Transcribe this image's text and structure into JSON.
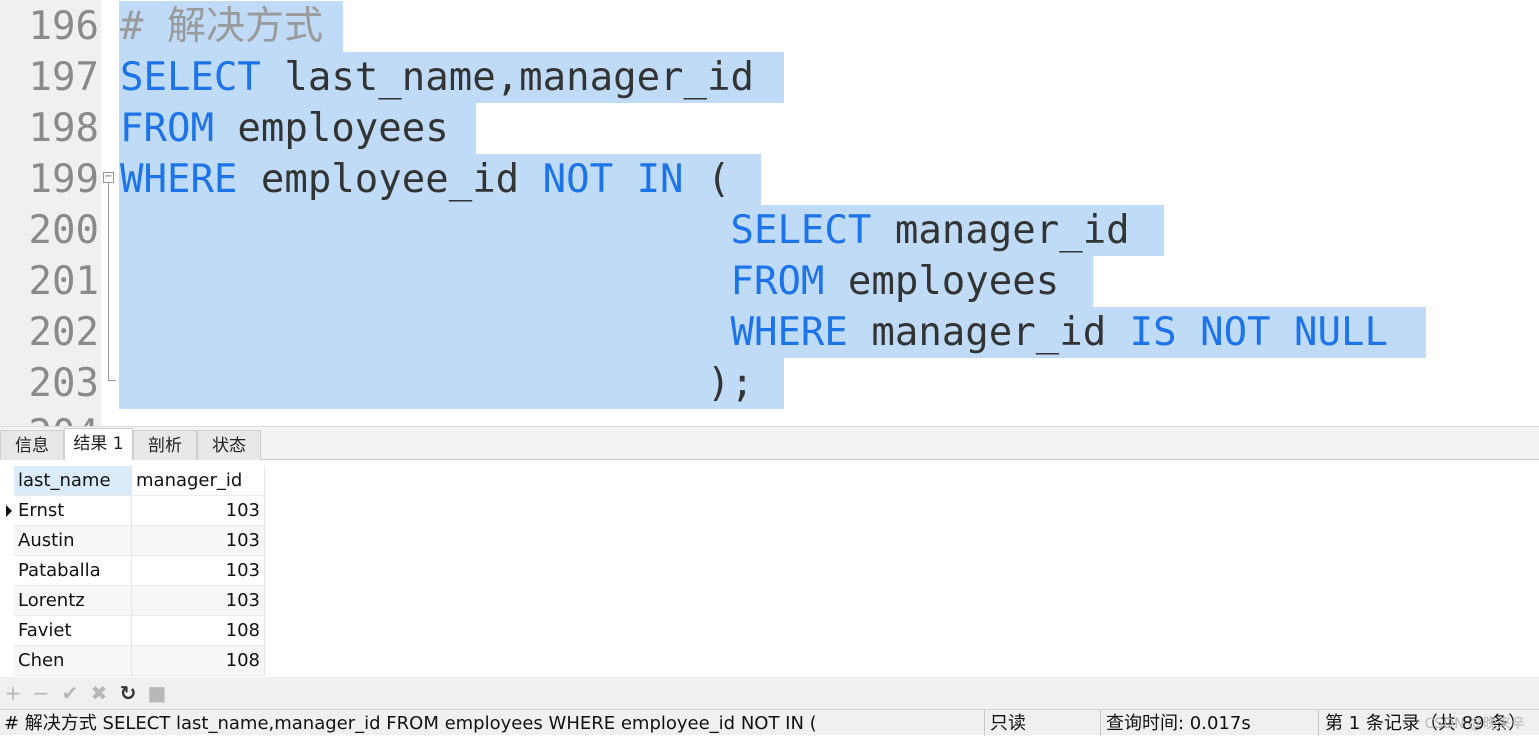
{
  "editor": {
    "lines": [
      {
        "num": "196",
        "parts": [
          {
            "t": "# 解决方式",
            "c": "cm"
          }
        ]
      },
      {
        "num": "197",
        "parts": [
          {
            "t": "SELECT",
            "c": "kw"
          },
          {
            "t": " last_name,manager_id",
            "c": "id"
          }
        ]
      },
      {
        "num": "198",
        "parts": [
          {
            "t": "FROM",
            "c": "kw"
          },
          {
            "t": " employees",
            "c": "id"
          }
        ]
      },
      {
        "num": "199",
        "parts": [
          {
            "t": "WHERE",
            "c": "kw"
          },
          {
            "t": " employee_id ",
            "c": "id"
          },
          {
            "t": "NOT IN",
            "c": "kw"
          },
          {
            "t": " (",
            "c": "id"
          }
        ]
      },
      {
        "num": "200",
        "parts": [
          {
            "t": "                          ",
            "c": "id"
          },
          {
            "t": "SELECT",
            "c": "kw"
          },
          {
            "t": " manager_id",
            "c": "id"
          }
        ]
      },
      {
        "num": "201",
        "parts": [
          {
            "t": "                          ",
            "c": "id"
          },
          {
            "t": "FROM",
            "c": "kw"
          },
          {
            "t": " employees",
            "c": "id"
          }
        ]
      },
      {
        "num": "202",
        "parts": [
          {
            "t": "                          ",
            "c": "id"
          },
          {
            "t": "WHERE",
            "c": "kw"
          },
          {
            "t": " manager_id ",
            "c": "id"
          },
          {
            "t": "IS NOT NULL",
            "c": "kw"
          }
        ]
      },
      {
        "num": "203",
        "parts": [
          {
            "t": "                         );",
            "c": "id"
          }
        ]
      },
      {
        "num": "204",
        "parts": []
      }
    ],
    "colors": {
      "keyword": "#1c74e8",
      "identifier": "#333333",
      "comment": "#9a9a9a",
      "selection": "#bfdbf7"
    }
  },
  "tabs": [
    {
      "label": "信息",
      "active": false
    },
    {
      "label": "结果 1",
      "active": true
    },
    {
      "label": "剖析",
      "active": false
    },
    {
      "label": "状态",
      "active": false
    }
  ],
  "grid": {
    "columns": [
      "last_name",
      "manager_id"
    ],
    "rows": [
      [
        "Ernst",
        "103"
      ],
      [
        "Austin",
        "103"
      ],
      [
        "Pataballa",
        "103"
      ],
      [
        "Lorentz",
        "103"
      ],
      [
        "Faviet",
        "108"
      ],
      [
        "Chen",
        "108"
      ]
    ]
  },
  "toolbar": [
    {
      "icon": "plus-icon",
      "glyph": "+",
      "enabled": false
    },
    {
      "icon": "minus-icon",
      "glyph": "−",
      "enabled": false
    },
    {
      "icon": "check-icon",
      "glyph": "✔",
      "enabled": false
    },
    {
      "icon": "cross-icon",
      "glyph": "✖",
      "enabled": false
    },
    {
      "icon": "refresh-icon",
      "glyph": "↻",
      "enabled": true
    },
    {
      "icon": "stop-icon",
      "glyph": "■",
      "enabled": false
    }
  ],
  "status": {
    "query": "# 解决方式 SELECT last_name,manager_id FROM employees  WHERE employee_id NOT IN (",
    "mode": "只读",
    "time": "查询时间: 0.017s",
    "records": "第 1 条记录（共 89 条）"
  },
  "watermark": "CSDN @晚来辛"
}
